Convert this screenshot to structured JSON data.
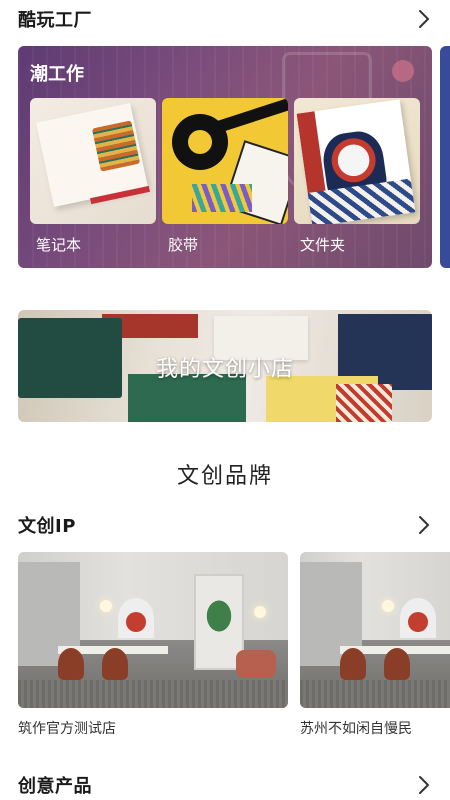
{
  "sections": {
    "top": {
      "title": "酷玩工厂"
    },
    "ip": {
      "title": "文创IP"
    },
    "products": {
      "title": "创意产品"
    }
  },
  "feature": {
    "title": "潮工作",
    "items": [
      {
        "label": "笔记本",
        "icon": "notebook-image"
      },
      {
        "label": "胶带",
        "icon": "tape-image"
      },
      {
        "label": "文件夹",
        "icon": "folder-image"
      }
    ],
    "accent": "#6f4a73"
  },
  "banner": {
    "text": "我的文创小店"
  },
  "brand_heading": "文创品牌",
  "stores": [
    {
      "name": "筑作官方测试店"
    },
    {
      "name": "苏州不如闲自慢民"
    }
  ],
  "icons": {
    "more": "chevron-right-icon"
  }
}
